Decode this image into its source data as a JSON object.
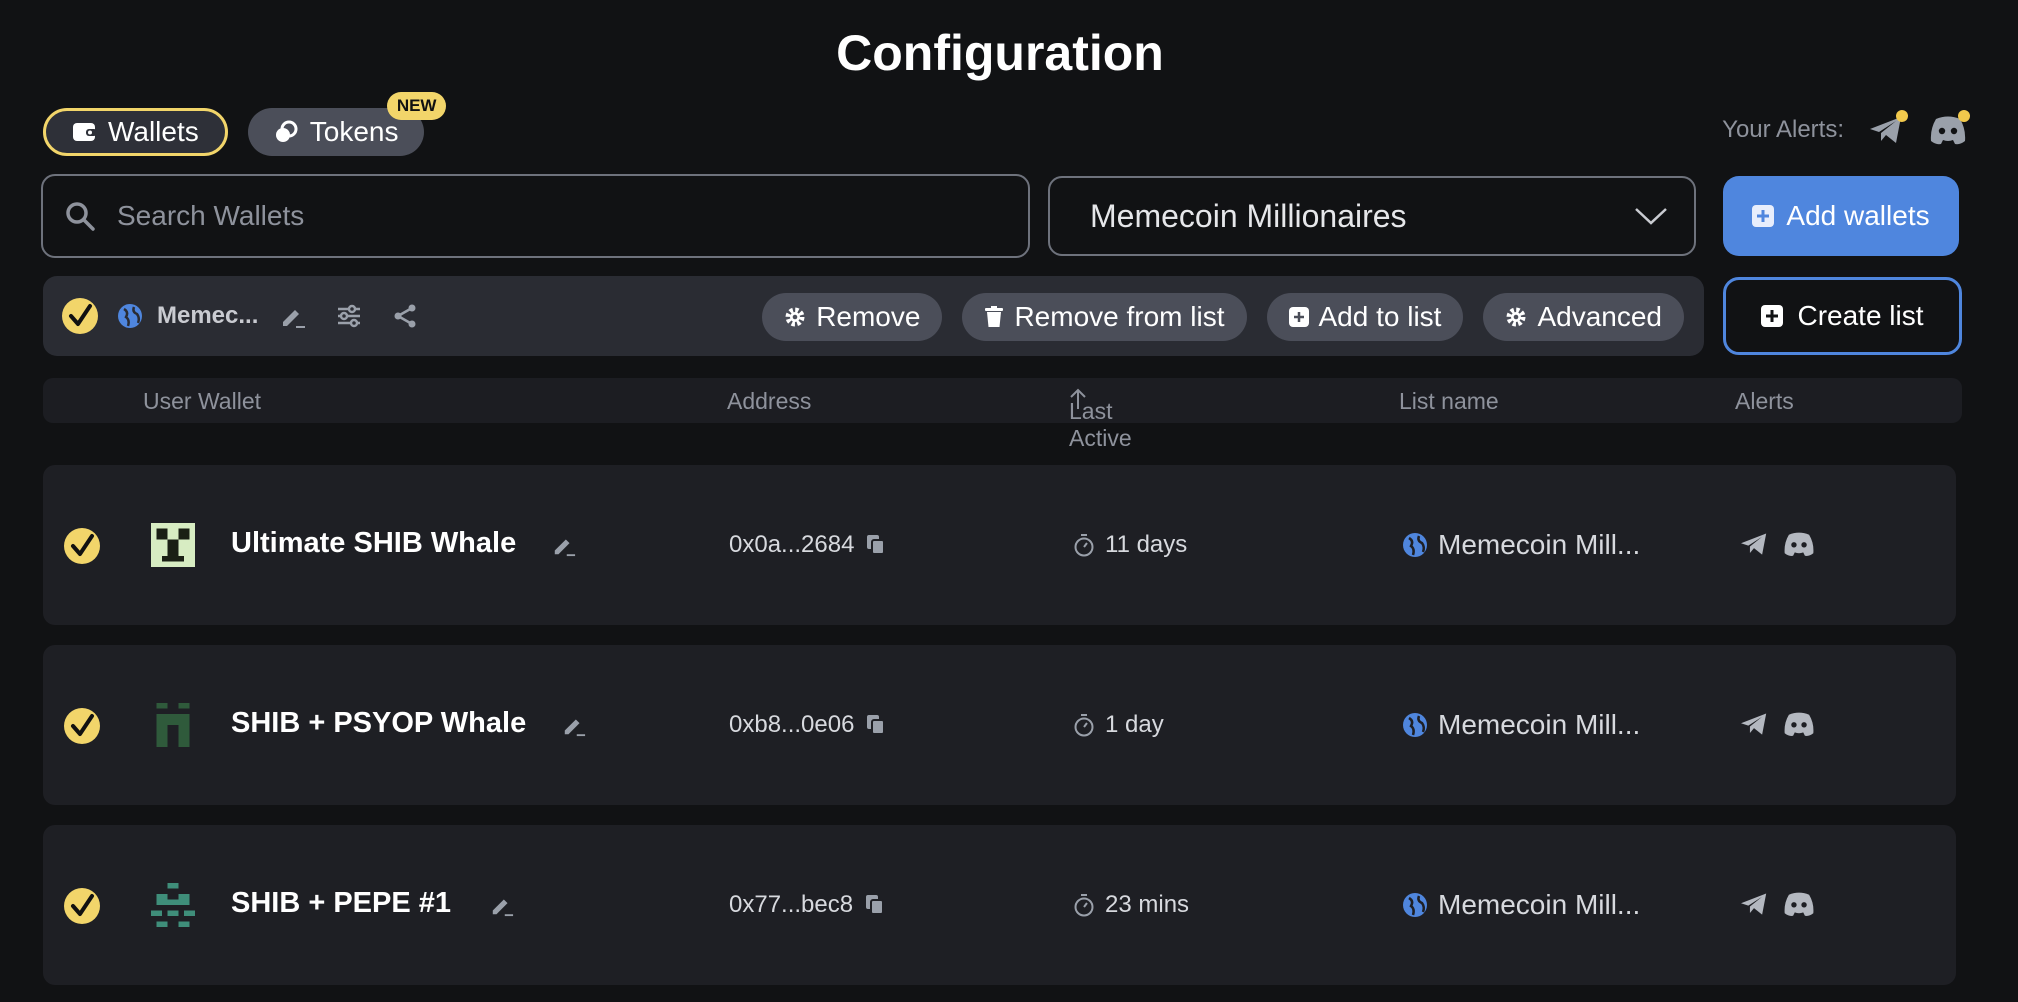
{
  "page": {
    "title": "Configuration"
  },
  "tabs": [
    {
      "label": "Wallets",
      "icon": "wallet-icon",
      "active": true
    },
    {
      "label": "Tokens",
      "icon": "coins-icon",
      "active": false,
      "badge": "NEW"
    }
  ],
  "alerts": {
    "label": "Your Alerts:",
    "icons": [
      "telegram-icon",
      "discord-icon"
    ]
  },
  "search": {
    "placeholder": "Search Wallets",
    "value": ""
  },
  "list_select": {
    "value": "Memecoin Millionaires"
  },
  "buttons": {
    "add_wallets": "Add wallets",
    "create_list": "Create list"
  },
  "toolbar": {
    "list_name": "Memec...",
    "actions": {
      "remove": "Remove",
      "remove_from_list": "Remove from list",
      "add_to_list": "Add to list",
      "advanced": "Advanced"
    }
  },
  "table": {
    "headers": {
      "user_wallet": "User Wallet",
      "address": "Address",
      "last_active": "Last Active",
      "list_name": "List name",
      "alerts": "Alerts"
    },
    "rows": [
      {
        "name": "Ultimate SHIB Whale",
        "address": "0x0a...2684",
        "last_active": "11 days",
        "list": "Memecoin Mill..."
      },
      {
        "name": "SHIB + PSYOP Whale",
        "address": "0xb8...0e06",
        "last_active": "1 day",
        "list": "Memecoin Mill..."
      },
      {
        "name": "SHIB + PEPE #1",
        "address": "0x77...bec8",
        "last_active": "23 mins",
        "list": "Memecoin Mill..."
      }
    ]
  },
  "colors": {
    "accent": "#4f86de",
    "highlight": "#f2d56a",
    "background": "#111214"
  }
}
